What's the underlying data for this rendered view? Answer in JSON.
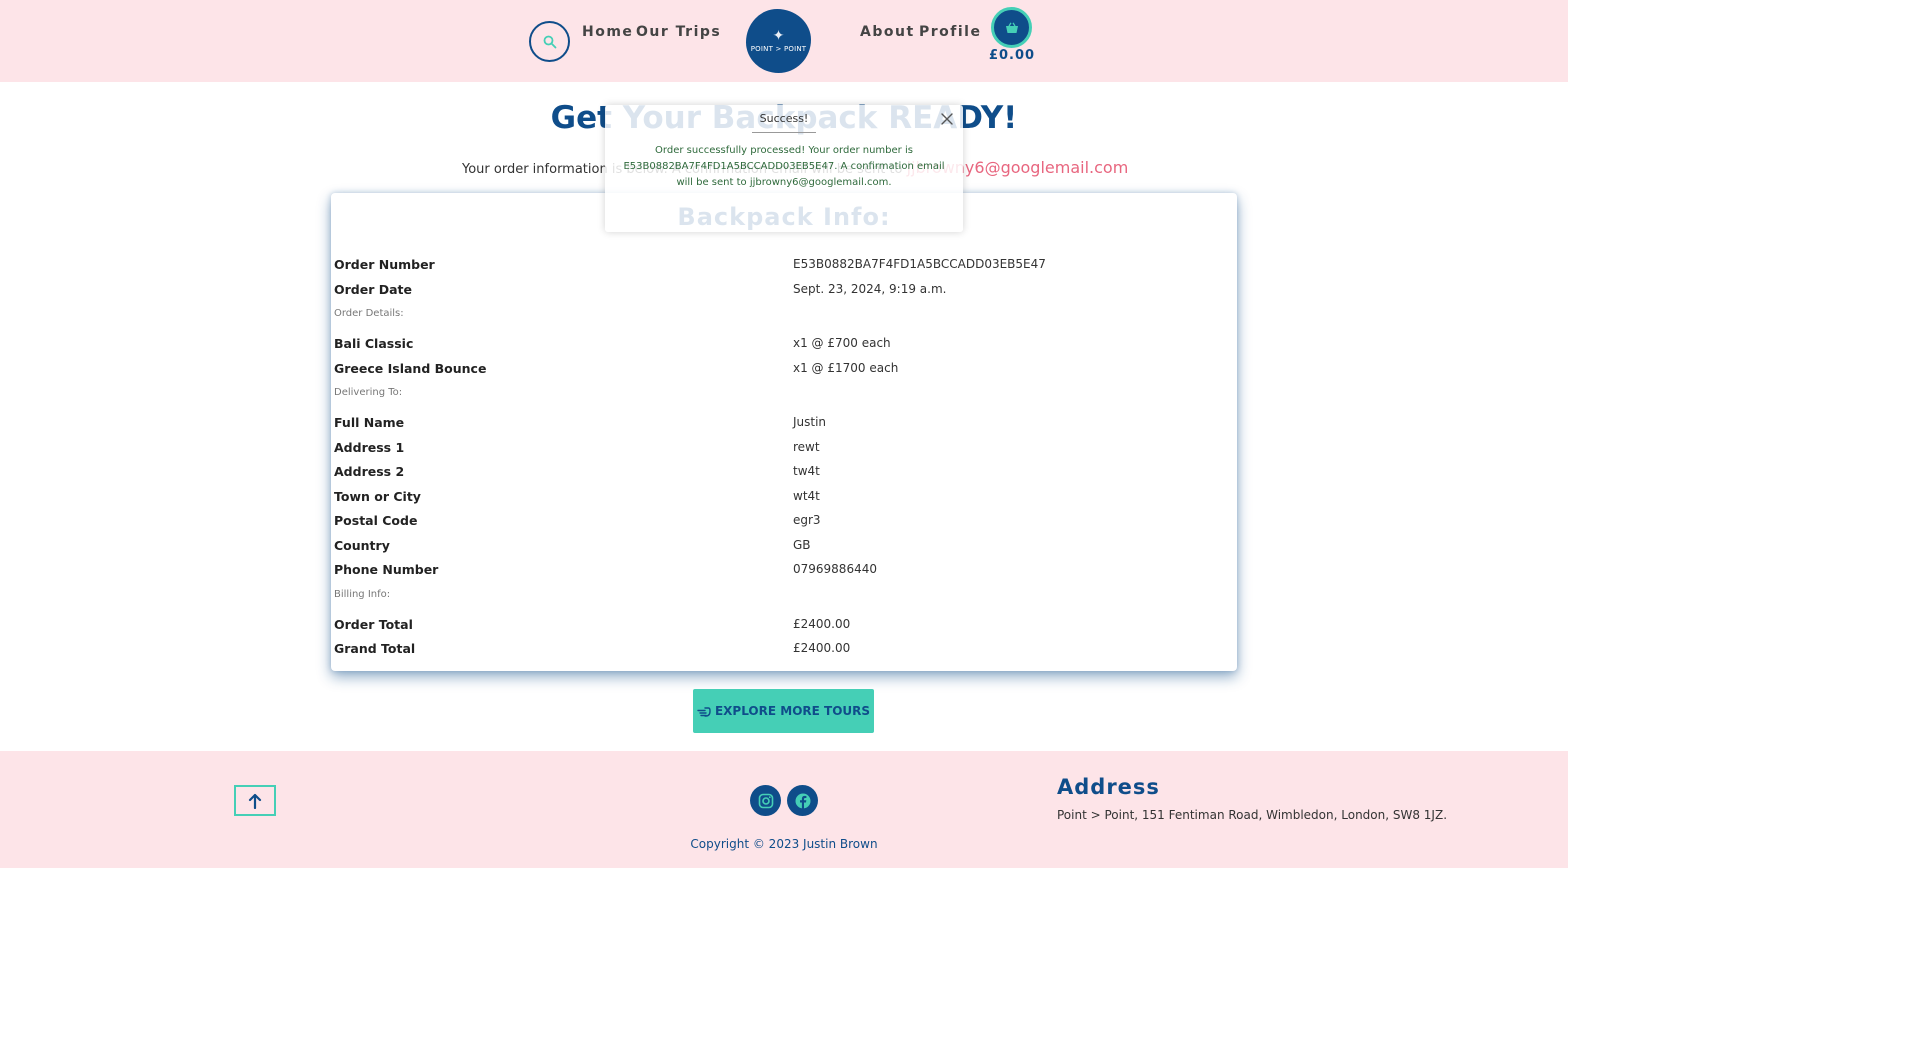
{
  "header": {
    "nav": {
      "home": "Home",
      "trips": "Our Trips",
      "about": "About",
      "profile": "Profile"
    },
    "logo_text": "POINT > POINT",
    "basket_total": "£0.00",
    "icons": {
      "search": "search-icon",
      "basket": "basket-icon"
    }
  },
  "main": {
    "title": "Get Your Backpack READY!",
    "intro_text": "Your order information is below. A confirmation email will be sent to",
    "intro_email": "jjbrowny6@googlemail.com",
    "card_title": "Backpack Info:",
    "order": {
      "number_label": "Order Number",
      "number_value": "E53B0882BA7F4FD1A5BCCADD03EB5E47",
      "date_label": "Order Date",
      "date_value": "Sept. 23, 2024, 9:19 a.m."
    },
    "sections": {
      "details": "Order Details:",
      "delivery": "Delivering To:",
      "billing": "Billing Info:"
    },
    "items": [
      {
        "name": "Bali Classic",
        "qty": "x1 @ £700 each"
      },
      {
        "name": "Greece Island Bounce",
        "qty": "x1 @ £1700 each"
      }
    ],
    "delivery": [
      {
        "label": "Full Name",
        "value": "Justin"
      },
      {
        "label": "Address 1",
        "value": "rewt"
      },
      {
        "label": "Address 2",
        "value": "tw4t"
      },
      {
        "label": "Town or City",
        "value": "wt4t"
      },
      {
        "label": "Postal Code",
        "value": "egr3"
      },
      {
        "label": "Country",
        "value": "GB"
      },
      {
        "label": "Phone Number",
        "value": "07969886440"
      }
    ],
    "billing": [
      {
        "label": "Order Total",
        "value": "£2400.00"
      },
      {
        "label": "Grand Total",
        "value": "£2400.00"
      }
    ],
    "explore_button": "EXPLORE MORE TOURS"
  },
  "toast": {
    "title": "Success!",
    "message": "Order successfully processed! Your order number is E53B0882BA7F4FD1A5BCCADD03EB5E47. A confirmation email will be sent to jjbrowny6@googlemail.com."
  },
  "footer": {
    "address_title": "Address",
    "address_text": "Point > Point, 151 Fentiman Road, Wimbledon, London, SW8 1JZ.",
    "copyright": "Copyright © 2023 Justin Brown",
    "icons": {
      "top": "arrow-up-icon",
      "instagram": "instagram-icon",
      "facebook": "facebook-icon"
    }
  },
  "colors": {
    "navy": "#0f4d8a",
    "teal": "#45cfb6",
    "pink_bg": "#fde4e8",
    "email_pink": "#e8667f",
    "success_green": "#2f6a3c"
  }
}
